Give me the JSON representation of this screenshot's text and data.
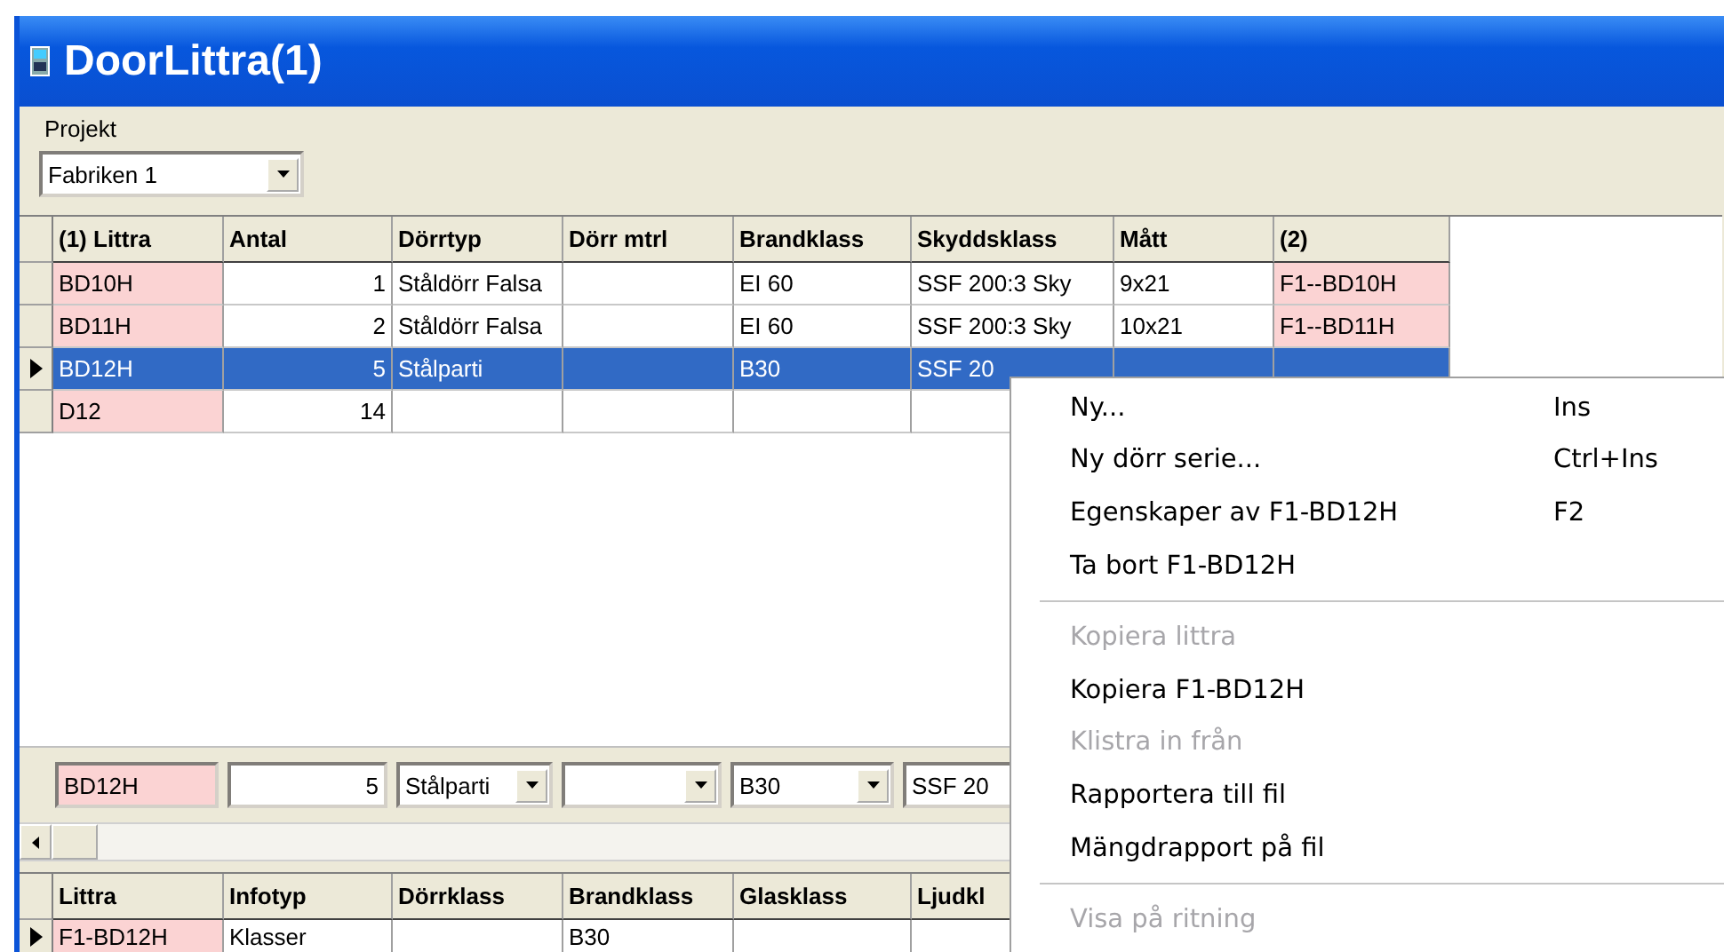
{
  "window": {
    "title": "DoorLittra(1)"
  },
  "project": {
    "label": "Projekt",
    "value": "Fabriken 1"
  },
  "grid": {
    "columns": [
      {
        "label": "(1) Littra",
        "kind": "key"
      },
      {
        "label": "Antal",
        "kind": "number"
      },
      {
        "label": "Dörrtyp",
        "kind": "text"
      },
      {
        "label": "Dörr mtrl",
        "kind": "text"
      },
      {
        "label": "Brandklass",
        "kind": "text"
      },
      {
        "label": "Skyddsklass",
        "kind": "text"
      },
      {
        "label": "Mått",
        "kind": "text"
      },
      {
        "label": "(2)",
        "kind": "key"
      }
    ],
    "rows": [
      {
        "selected": false,
        "cells": [
          "BD10H",
          "1",
          "Ståldörr Falsa",
          "",
          "EI 60",
          "SSF 200:3 Sky",
          "9x21",
          "F1--BD10H"
        ]
      },
      {
        "selected": false,
        "cells": [
          "BD11H",
          "2",
          "Ståldörr Falsa",
          "",
          "EI 60",
          "SSF 200:3 Sky",
          "10x21",
          "F1--BD11H"
        ]
      },
      {
        "selected": true,
        "cells": [
          "BD12H",
          "5",
          "Stålparti",
          "",
          "B30",
          "SSF 20"
        ]
      },
      {
        "selected": false,
        "cells": [
          "D12",
          "14"
        ]
      }
    ]
  },
  "editor": [
    {
      "kind": "key-field",
      "value": "BD12H"
    },
    {
      "kind": "number-field",
      "value": "5"
    },
    {
      "kind": "combo",
      "value": "Stålparti"
    },
    {
      "kind": "combo"
    },
    {
      "kind": "combo",
      "value": "B30"
    },
    {
      "kind": "text-field",
      "value": "SSF 20"
    }
  ],
  "detail_grid": {
    "columns": [
      {
        "label": "Littra",
        "kind": "key"
      },
      {
        "label": "Infotyp",
        "kind": "text"
      },
      {
        "label": "Dörrklass",
        "kind": "text"
      },
      {
        "label": "Brandklass",
        "kind": "text"
      },
      {
        "label": "Glasklass",
        "kind": "text"
      },
      {
        "label": "Ljudkl"
      }
    ],
    "rows": [
      {
        "selected": true,
        "cells": [
          "F1-BD12H",
          "Klasser",
          "",
          "B30"
        ]
      }
    ]
  },
  "context_menu": [
    {
      "kind": "item",
      "label": "Ny...",
      "shortcut": "Ins",
      "disabled": false
    },
    {
      "kind": "item",
      "label": "Ny dörr serie...",
      "shortcut": "Ctrl+Ins",
      "disabled": false
    },
    {
      "kind": "item",
      "label": "Egenskaper av F1-BD12H",
      "shortcut": "F2",
      "disabled": false
    },
    {
      "kind": "item",
      "label": "Ta bort F1-BD12H",
      "disabled": false
    },
    {
      "kind": "separator"
    },
    {
      "kind": "item",
      "label": "Kopiera littra",
      "disabled": true
    },
    {
      "kind": "item",
      "label": "Kopiera F1-BD12H",
      "disabled": false
    },
    {
      "kind": "item",
      "label": "Klistra in från",
      "disabled": true
    },
    {
      "kind": "item",
      "label": "Rapportera till fil",
      "disabled": false
    },
    {
      "kind": "item",
      "label": "Mängdrapport på fil",
      "disabled": false
    },
    {
      "kind": "separator"
    },
    {
      "kind": "item",
      "label": "Visa på ritning",
      "disabled": true
    }
  ]
}
